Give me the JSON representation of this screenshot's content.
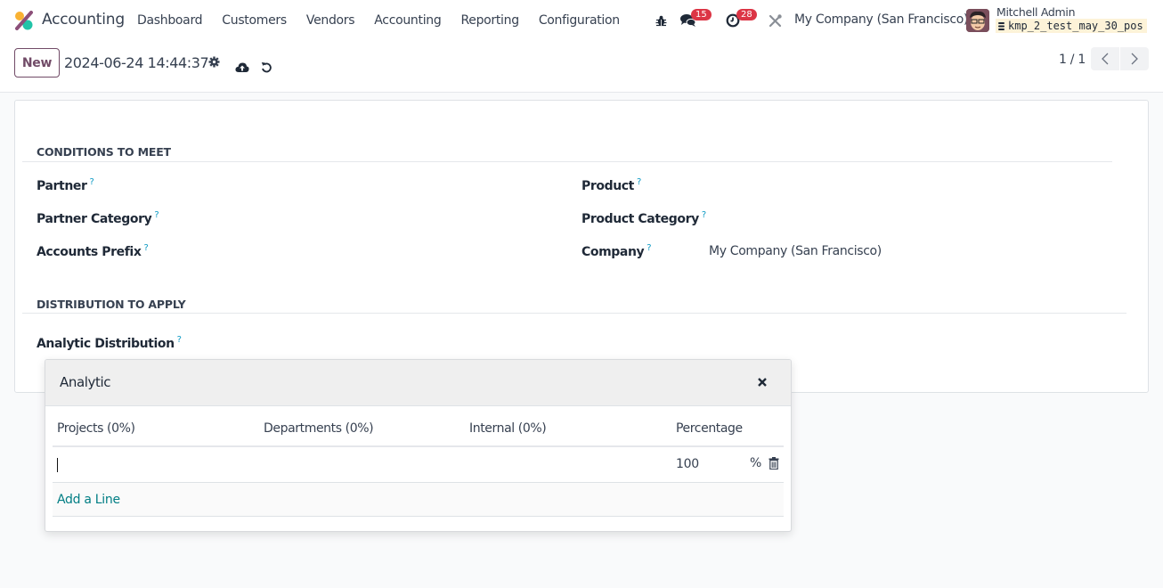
{
  "navbar": {
    "app_name": "Accounting",
    "menu": [
      "Dashboard",
      "Customers",
      "Vendors",
      "Accounting",
      "Reporting",
      "Configuration"
    ],
    "messages_badge": "15",
    "activities_badge": "28",
    "company": "My Company (San Francisco)",
    "user_name": "Mitchell Admin",
    "database": "kmp_2_test_may_30_pos"
  },
  "control_panel": {
    "new_label": "New",
    "record_name": "2024-06-24 14:44:37",
    "pager": "1 / 1"
  },
  "form": {
    "section_conditions": "CONDITIONS TO MEET",
    "section_distribution": "DISTRIBUTION TO APPLY",
    "help_mark": "?",
    "left_fields": [
      {
        "label": "Partner",
        "value": ""
      },
      {
        "label": "Partner Category",
        "value": ""
      },
      {
        "label": "Accounts Prefix",
        "value": ""
      }
    ],
    "right_fields": [
      {
        "label": "Product",
        "value": ""
      },
      {
        "label": "Product Category",
        "value": ""
      },
      {
        "label": "Company",
        "value": "My Company (San Francisco)"
      }
    ],
    "analytic_label": "Analytic Distribution"
  },
  "popover": {
    "title": "Analytic",
    "columns": [
      "Projects (0%)",
      "Departments (0%)",
      "Internal (0%)",
      "Percentage"
    ],
    "rows": [
      {
        "projects": "",
        "departments": "",
        "internal": "",
        "percentage": "100",
        "unit": "%"
      }
    ],
    "add_line": "Add a Line"
  },
  "colors": {
    "brand": "#714b67",
    "link": "#017e84",
    "badge": "#dc3545",
    "help": "#0d9ac4"
  }
}
